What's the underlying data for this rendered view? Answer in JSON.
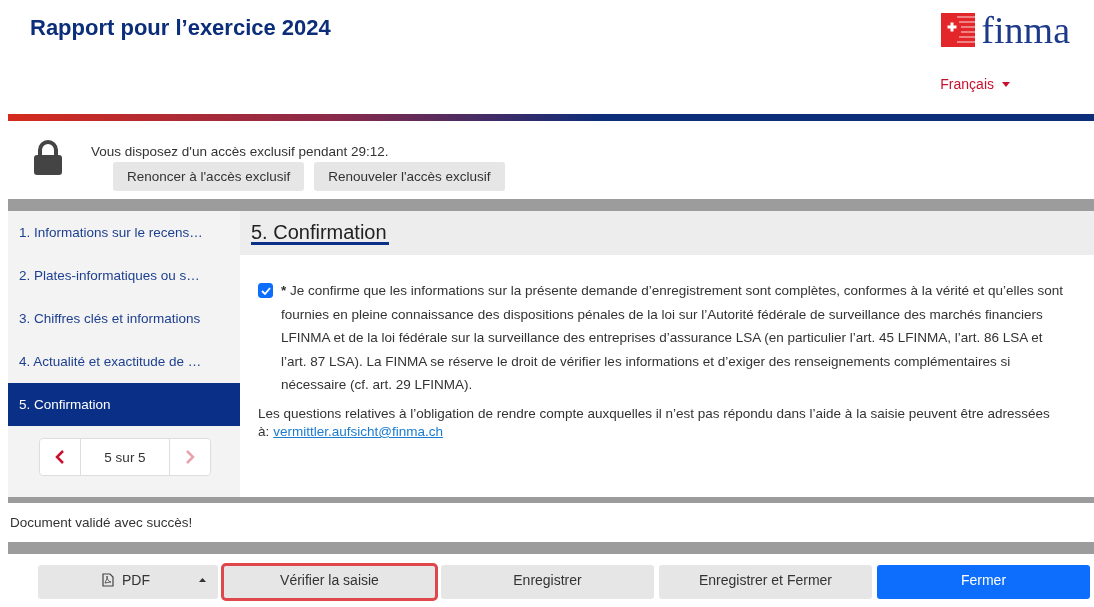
{
  "header": {
    "title": "Rapport pour l’exercice 2024",
    "logo_text": "finma",
    "language": "Français"
  },
  "lock": {
    "message": "Vous disposez d'un accès exclusif pendant 29:12.",
    "buttons": [
      "Renoncer à l'accès exclusif",
      "Renouveler l'accès exclusif"
    ]
  },
  "sidebar": {
    "items": [
      {
        "label": "1. Informations sur le recens…",
        "selected": false
      },
      {
        "label": "2. Plates-informatiques ou s…",
        "selected": false
      },
      {
        "label": "3. Chiffres clés et informations",
        "selected": false
      },
      {
        "label": "4. Actualité et exactitude de …",
        "selected": false
      },
      {
        "label": "5. Confirmation",
        "selected": true
      }
    ],
    "pager": {
      "text": "5 sur 5",
      "prev_disabled": false,
      "next_disabled": true
    }
  },
  "section": {
    "heading": "5. Confirmation",
    "confirmation": {
      "checked": true,
      "required_mark": "*",
      "text": "Je confirme que les informations sur la présente demande d’enregistrement sont complètes, conformes à la vérité et qu’elles sont fournies en pleine connaissance des dispositions pénales de la loi sur l’Autorité fédérale de surveillance des marchés financiers LFINMA et de la loi fédérale sur la surveillance des entreprises d’assurance LSA (en particulier l’art. 45 LFINMA, l’art. 86 LSA et l’art. 87 LSA). La FINMA se réserve le droit de vérifier les informations et d’exiger des renseignements complémentaires si nécessaire (cf. art. 29 LFINMA)."
    },
    "questions": {
      "text": "Les questions relatives à l’obligation de rendre compte auxquelles il n’est pas répondu dans l’aide à la saisie peuvent être adressées à:",
      "link": "vermittler.aufsicht@finma.ch"
    }
  },
  "status_message": "Document validé avec succès!",
  "actions": [
    {
      "kind": "pdf",
      "label": "PDF",
      "focused": false
    },
    {
      "kind": "plain",
      "label": "Vérifier la saisie",
      "focused": true
    },
    {
      "kind": "plain",
      "label": "Enregistrer",
      "focused": false
    },
    {
      "kind": "plain",
      "label": "Enregistrer et Fermer",
      "focused": false
    },
    {
      "kind": "primary",
      "label": "Fermer",
      "focused": false
    }
  ]
}
